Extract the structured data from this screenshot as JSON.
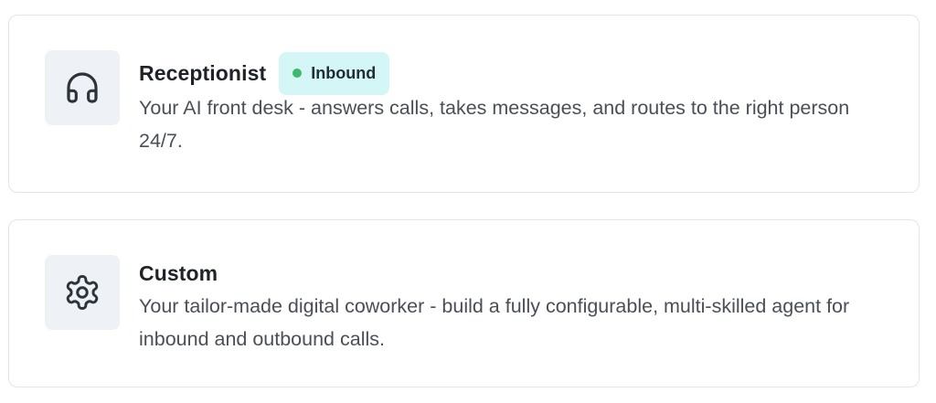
{
  "colors": {
    "card_border": "#e3e5e8",
    "icon_tile_bg": "#eef1f5",
    "badge_bg": "#d5f6f6",
    "badge_dot": "#3fb86b",
    "title_text": "#1f2328",
    "description_text": "#4a4f57"
  },
  "cards": [
    {
      "icon": "headphones-icon",
      "title": "Receptionist",
      "badge": {
        "label": "Inbound",
        "dot_color": "#3fb86b"
      },
      "description": "Your AI front desk - answers calls, takes messages, and routes to the right person 24/7."
    },
    {
      "icon": "gear-icon",
      "title": "Custom",
      "description": "Your tailor-made digital coworker - build a fully configurable, multi-skilled agent for inbound and outbound calls."
    }
  ]
}
